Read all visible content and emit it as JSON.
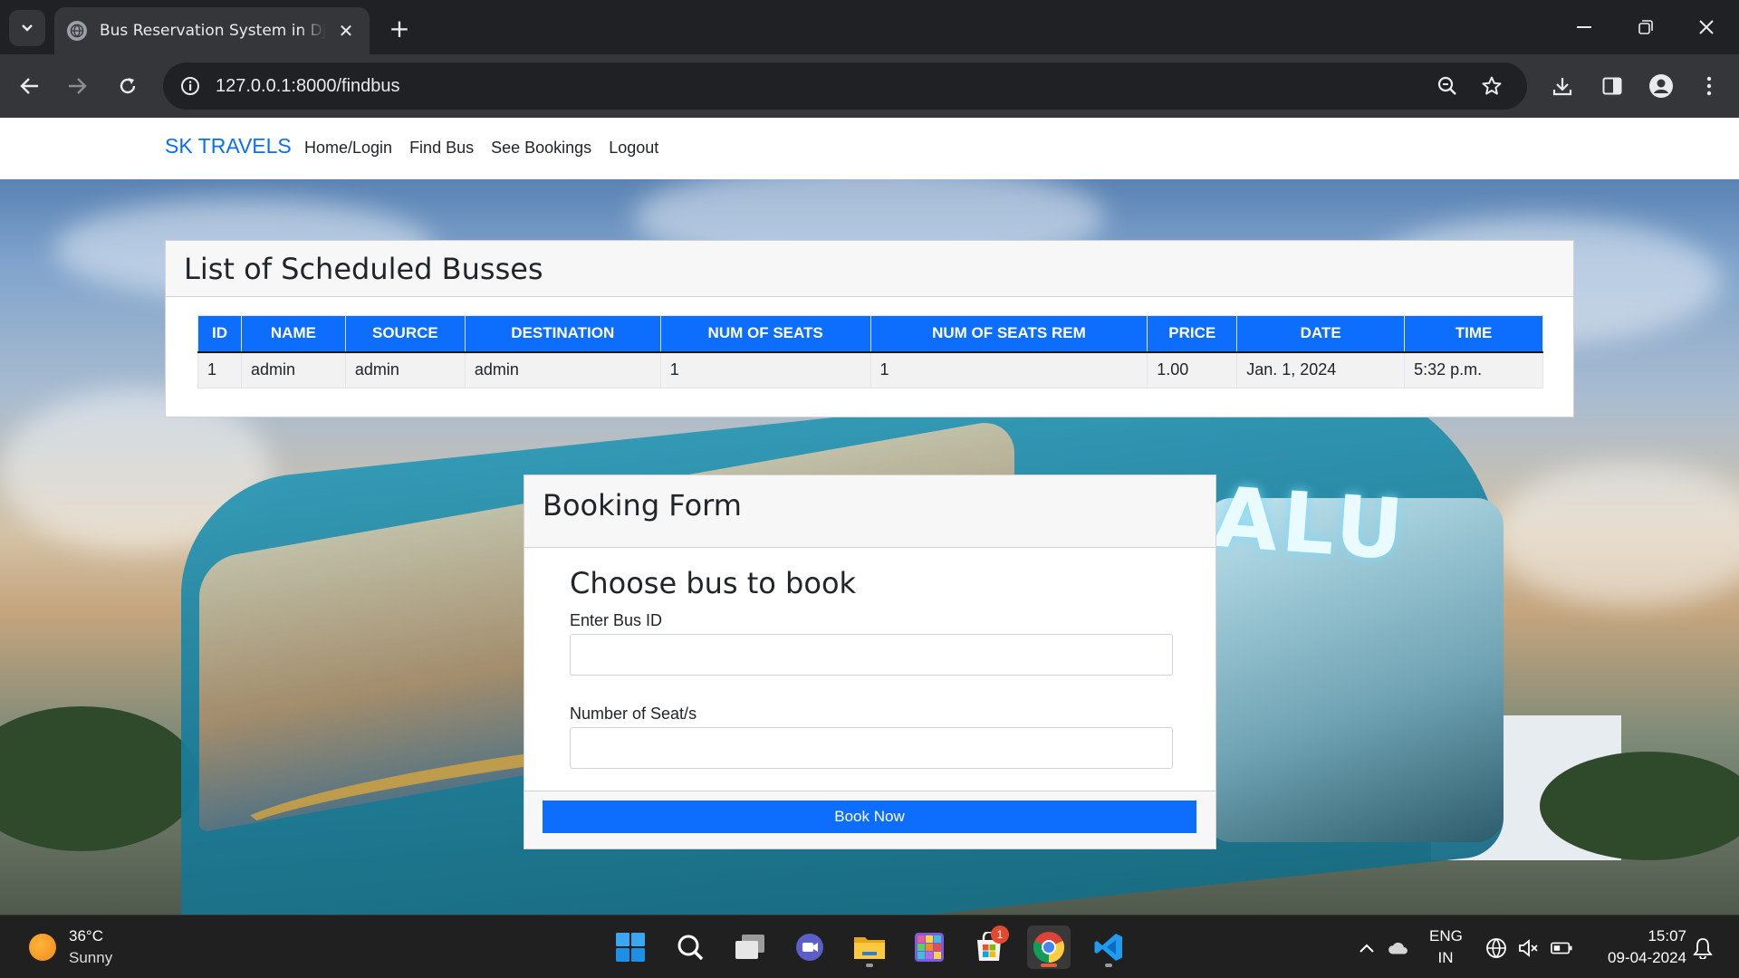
{
  "browser": {
    "tab_title": "Bus Reservation System in Django",
    "url": "127.0.0.1:8000/findbus"
  },
  "site": {
    "brand": "SK TRAVELS",
    "nav": [
      "Home/Login",
      "Find Bus",
      "See Bookings",
      "Logout"
    ]
  },
  "bus_list": {
    "title": "List of Scheduled Busses",
    "columns": [
      "ID",
      "NAME",
      "SOURCE",
      "DESTINATION",
      "NUM OF SEATS",
      "NUM OF SEATS REM",
      "PRICE",
      "DATE",
      "TIME"
    ],
    "rows": [
      [
        "1",
        "admin",
        "admin",
        "admin",
        "1",
        "1",
        "1.00",
        "Jan. 1, 2024",
        "5:32 p.m."
      ]
    ]
  },
  "booking_form": {
    "title": "Booking Form",
    "heading": "Choose bus to book",
    "bus_id_label": "Enter Bus ID",
    "bus_id_value": "",
    "seats_label": "Number of Seat/s",
    "seats_value": "",
    "submit_label": "Book Now"
  },
  "background": {
    "bus_logo_text": "ALU"
  },
  "taskbar": {
    "weather_temp": "36°C",
    "weather_cond": "Sunny",
    "store_badge": "1",
    "lang_top": "ENG",
    "lang_bottom": "IN",
    "time": "15:07",
    "date": "09-04-2024"
  },
  "colors": {
    "primary": "#0d6efd",
    "chrome_dark": "#202124",
    "chrome_toolbar": "#35363a",
    "taskbar": "#202020"
  }
}
